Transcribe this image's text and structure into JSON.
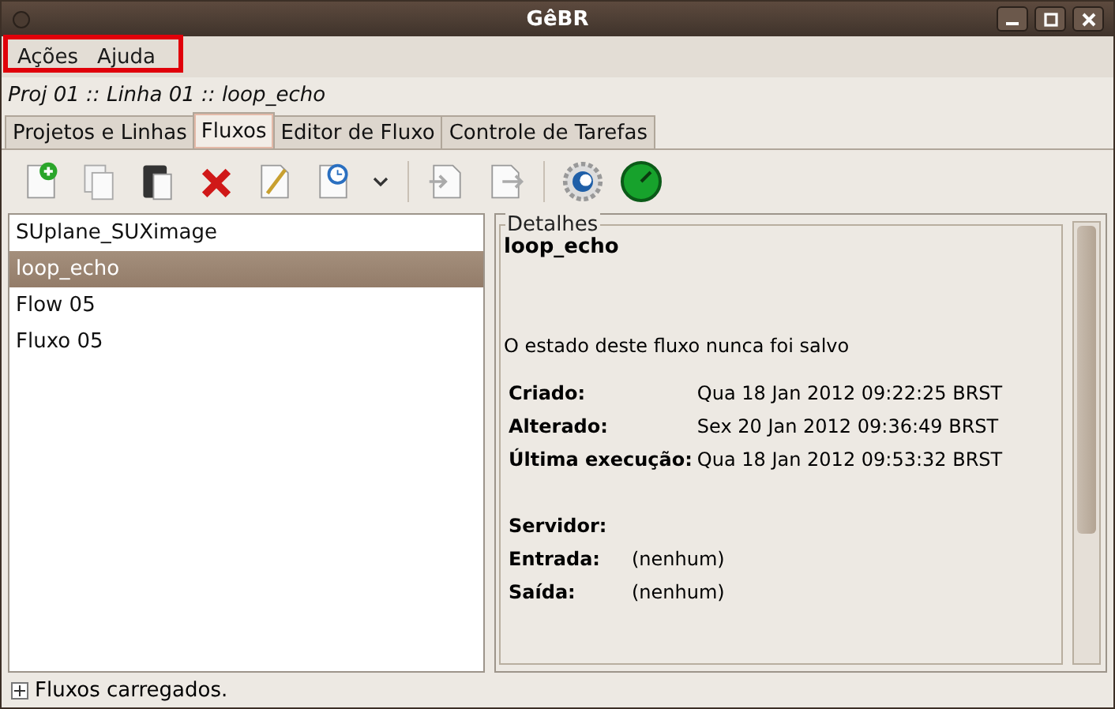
{
  "window": {
    "title": "GêBR"
  },
  "menu": [
    {
      "label": "Ações"
    },
    {
      "label": "Ajuda"
    }
  ],
  "breadcrumb": "Proj 01 :: Linha 01 :: loop_echo",
  "tabs": [
    {
      "label": "Projetos e Linhas",
      "selected": false
    },
    {
      "label": "Fluxos",
      "selected": true
    },
    {
      "label": "Editor de Fluxo",
      "selected": false
    },
    {
      "label": "Controle de Tarefas",
      "selected": false
    }
  ],
  "toolbar": [
    {
      "kind": "new"
    },
    {
      "kind": "copy"
    },
    {
      "kind": "paste"
    },
    {
      "kind": "delete"
    },
    {
      "kind": "edit"
    },
    {
      "kind": "history"
    },
    {
      "kind": "dropdown"
    },
    {
      "kind": "separator"
    },
    {
      "kind": "import"
    },
    {
      "kind": "export"
    },
    {
      "kind": "separator"
    },
    {
      "kind": "settings"
    },
    {
      "kind": "run"
    }
  ],
  "flows": [
    {
      "label": "SUplane_SUXimage",
      "selected": false
    },
    {
      "label": "loop_echo",
      "selected": true
    },
    {
      "label": "Flow 05",
      "selected": false
    },
    {
      "label": "Fluxo 05",
      "selected": false
    }
  ],
  "details": {
    "legend": "Detalhes",
    "name": "loop_echo",
    "state": "O estado deste fluxo nunca foi salvo",
    "dates": [
      {
        "label": "Criado:",
        "value": "Qua 18 Jan 2012 09:22:25 BRST"
      },
      {
        "label": "Alterado:",
        "value": "Sex 20 Jan 2012 09:36:49 BRST"
      },
      {
        "label": "Última execução:",
        "value": "Qua 18 Jan 2012 09:53:32 BRST"
      }
    ],
    "server": {
      "label": "Servidor:"
    },
    "io": [
      {
        "label": "Entrada:",
        "value": "(nenhum)"
      },
      {
        "label": "Saída:",
        "value": "(nenhum)"
      }
    ]
  },
  "status_bar": {
    "text": "Fluxos carregados.",
    "expanded": false
  }
}
